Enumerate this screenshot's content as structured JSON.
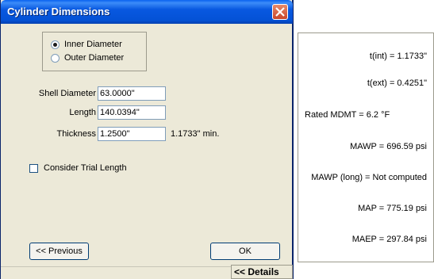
{
  "dialog": {
    "title": "Cylinder Dimensions",
    "diameter_options": [
      {
        "label": "Inner Diameter",
        "selected": true
      },
      {
        "label": "Outer Diameter",
        "selected": false
      }
    ],
    "fields": {
      "shell_diameter": {
        "label": "Shell Diameter",
        "value": "63.0000\""
      },
      "length": {
        "label": "Length",
        "value": "140.0394\""
      },
      "thickness": {
        "label": "Thickness",
        "value": "1.2500\"",
        "min_note": "1.1733\" min."
      }
    },
    "consider_trial_length": {
      "label": "Consider Trial Length",
      "checked": false
    },
    "buttons": {
      "previous": "<< Previous",
      "ok": "OK",
      "details": "<< Details"
    }
  },
  "results": [
    "t(int) = 1.1733\"",
    "t(ext) = 0.4251\"",
    "Rated MDMT = 6.2  °F",
    "MAWP = 696.59 psi",
    "MAWP (long) = Not computed",
    "MAP = 775.19 psi",
    "MAEP = 297.84 psi"
  ],
  "colors": {
    "titlebar": "#0452d6",
    "dialog_bg": "#ece9d8",
    "close_button": "#c8462a"
  }
}
